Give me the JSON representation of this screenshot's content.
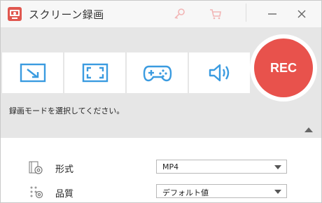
{
  "window": {
    "title": "スクリーン録画",
    "icons": [
      "key-icon",
      "cart-icon",
      "minimize-icon",
      "close-icon"
    ]
  },
  "modes": {
    "buttons": [
      {
        "name": "region-capture",
        "icon": "region-select-icon"
      },
      {
        "name": "fullscreen-capture",
        "icon": "fullscreen-icon"
      },
      {
        "name": "game-capture",
        "icon": "gamepad-icon"
      },
      {
        "name": "audio-capture",
        "icon": "speaker-icon"
      }
    ],
    "rec_label": "REC",
    "hint": "録画モードを選択してください。"
  },
  "settings": {
    "format_label": "形式",
    "format_value": "MP4",
    "quality_label": "品質",
    "quality_value": "デフォルト値"
  },
  "colors": {
    "accent_blue": "#3a9be0",
    "rec_red": "#e8524c",
    "toolbar_pink": "#f2b5b5",
    "panel_gray": "#e6e6e6"
  }
}
